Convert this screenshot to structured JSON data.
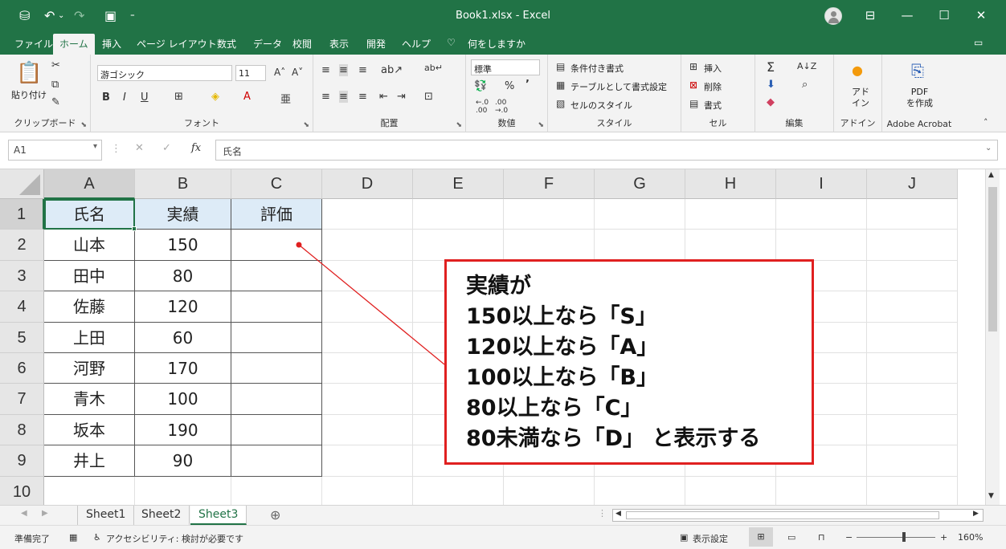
{
  "window": {
    "title": "Book1.xlsx  -  Excel",
    "quick_access": [
      "autosave-icon",
      "undo-icon",
      "redo-icon",
      "save-icon"
    ],
    "controls": [
      "ribbon-display-icon",
      "minimize-icon",
      "maximize-icon",
      "close-icon"
    ]
  },
  "menu": {
    "tabs": [
      "ファイル",
      "ホーム",
      "挿入",
      "ページ レイアウト",
      "数式",
      "データ",
      "校閲",
      "表示",
      "開発",
      "ヘルプ"
    ],
    "active": "ホーム",
    "search": "何をしますか"
  },
  "ribbon": {
    "clipboard": {
      "paste": "貼り付け",
      "label": "クリップボード"
    },
    "font": {
      "name": "游ゴシック",
      "size": "11",
      "label": "フォント",
      "bold": "B",
      "italic": "I",
      "underline": "U"
    },
    "alignment": {
      "label": "配置"
    },
    "number": {
      "format": "標準",
      "percent": "%",
      "comma": "’",
      "label": "数値"
    },
    "styles": {
      "conditional": "条件付き書式",
      "table": "テーブルとして書式設定",
      "cell": "セルのスタイル",
      "label": "スタイル"
    },
    "cells": {
      "insert": "挿入",
      "delete": "削除",
      "format": "書式",
      "label": "セル"
    },
    "editing": {
      "sum": "Σ",
      "label": "編集"
    },
    "addins": {
      "button": "アド\nイン",
      "label": "アドイン"
    },
    "acrobat": {
      "button": "PDF\nを作成",
      "label": "Adobe Acrobat"
    }
  },
  "formula_bar": {
    "name_box": "A1",
    "fx": "fx",
    "content": "氏名"
  },
  "grid": {
    "columns": [
      "A",
      "B",
      "C",
      "D",
      "E",
      "F",
      "G",
      "H",
      "I",
      "J"
    ],
    "rows": [
      "1",
      "2",
      "3",
      "4",
      "5",
      "6",
      "7",
      "8",
      "9",
      "10"
    ],
    "header": [
      "氏名",
      "実績",
      "評価"
    ],
    "data": [
      [
        "山本",
        "150",
        ""
      ],
      [
        "田中",
        "80",
        ""
      ],
      [
        "佐藤",
        "120",
        ""
      ],
      [
        "上田",
        "60",
        ""
      ],
      [
        "河野",
        "170",
        ""
      ],
      [
        "青木",
        "100",
        ""
      ],
      [
        "坂本",
        "190",
        ""
      ],
      [
        "井上",
        "90",
        ""
      ]
    ]
  },
  "callout": {
    "lines": [
      "実績が",
      "150以上なら「S」",
      "120以上なら「A」",
      "100以上なら「B」",
      "80以上なら「C」",
      "80未満なら「D」 と表示する"
    ],
    "border_color": "#e02020"
  },
  "sheets": {
    "tabs": [
      "Sheet1",
      "Sheet2",
      "Sheet3"
    ],
    "active": "Sheet3",
    "add": "⊕"
  },
  "status": {
    "ready": "準備完了",
    "accessibility": "アクセシビリティ: 検討が必要です",
    "display_settings": "表示設定",
    "zoom": "160%"
  },
  "colors": {
    "accent": "#217346",
    "header_fill": "#ddebf7"
  }
}
